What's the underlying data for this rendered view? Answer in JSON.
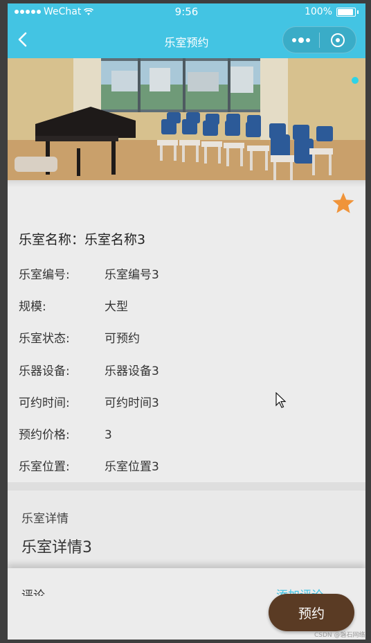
{
  "status_bar": {
    "carrier": "WeChat",
    "time": "9:56",
    "battery": "100%"
  },
  "nav": {
    "title": "乐室预约"
  },
  "room": {
    "name_line": "乐室名称：乐室名称3",
    "fields": [
      {
        "label": "乐室编号:",
        "value": "乐室编号3"
      },
      {
        "label": "规模:",
        "value": "大型"
      },
      {
        "label": "乐室状态:",
        "value": "可预约"
      },
      {
        "label": "乐器设备:",
        "value": "乐器设备3"
      },
      {
        "label": "可约时间:",
        "value": "可约时间3"
      },
      {
        "label": "预约价格:",
        "value": "3"
      },
      {
        "label": "乐室位置:",
        "value": "乐室位置3"
      }
    ]
  },
  "detail": {
    "label": "乐室详情",
    "value": "乐室详情3"
  },
  "bottom": {
    "partial_left": "评论",
    "partial_right": "添加评论",
    "book_label": "预约"
  },
  "watermark": "CSDN @磐石网络",
  "colors": {
    "primary": "#43c4e3",
    "book_button": "#5a3b24",
    "star": "#f0943a"
  }
}
